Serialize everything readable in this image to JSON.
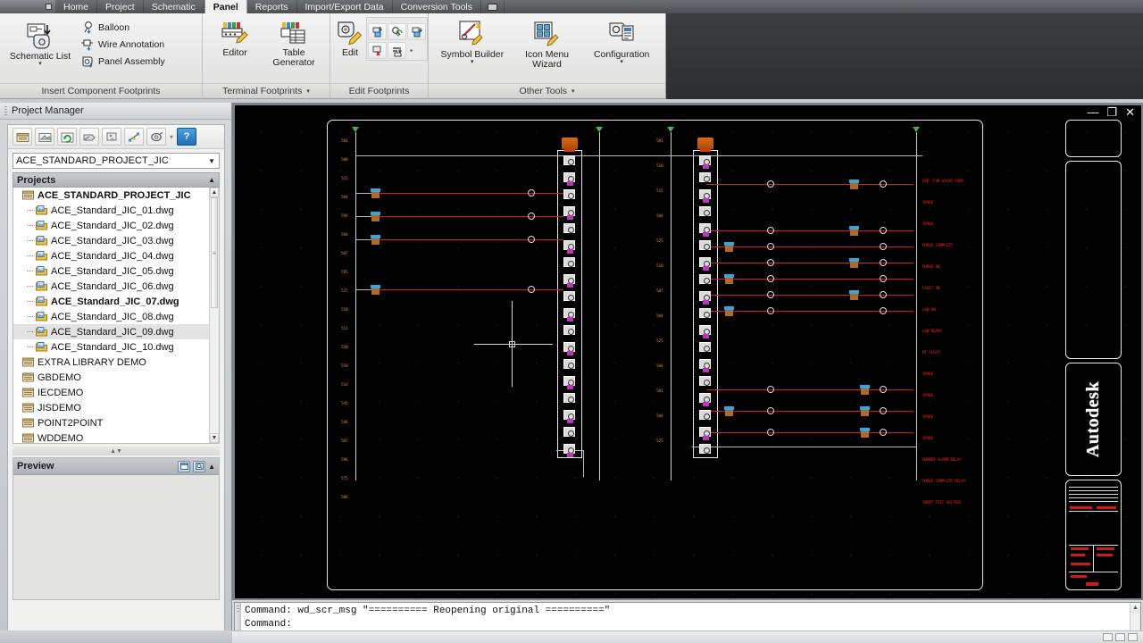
{
  "window": {
    "app_button": "application-menu",
    "controls": {
      "minimize": "—",
      "restore": "❐",
      "close": "✕"
    }
  },
  "ribbon_tabs": [
    {
      "label": "Home",
      "active": false
    },
    {
      "label": "Project",
      "active": false
    },
    {
      "label": "Schematic",
      "active": false
    },
    {
      "label": "Panel",
      "active": true
    },
    {
      "label": "Reports",
      "active": false
    },
    {
      "label": "Import/Export Data",
      "active": false
    },
    {
      "label": "Conversion Tools",
      "active": false
    }
  ],
  "ribbon_panels": [
    {
      "title": "Insert Component Footprints",
      "has_dropdown": false,
      "big": [
        {
          "label": "Schematic List",
          "icon": "schematic-list-icon",
          "split": true
        }
      ],
      "small": [
        {
          "label": "Balloon",
          "icon": "balloon-icon"
        },
        {
          "label": "Wire Annotation",
          "icon": "wire-annotation-icon"
        },
        {
          "label": "Panel Assembly",
          "icon": "panel-assembly-icon"
        }
      ]
    },
    {
      "title": "Terminal Footprints",
      "has_dropdown": true,
      "big": [
        {
          "label": "Editor",
          "icon": "terminal-editor-icon",
          "split": false
        },
        {
          "label": "Table Generator",
          "icon": "table-generator-icon",
          "split": false
        }
      ],
      "small": []
    },
    {
      "title": "Edit Footprints",
      "has_dropdown": false,
      "big": [
        {
          "label": "Edit",
          "icon": "edit-footprint-icon",
          "split": false
        }
      ],
      "grid": [
        "copy-footprint-icon",
        "find-replace-icon",
        "swap-footprint-icon",
        "delete-footprint-icon",
        "attribute-icon",
        "more-icon"
      ]
    },
    {
      "title": "Other Tools",
      "has_dropdown": true,
      "big": [
        {
          "label": "Symbol Builder",
          "icon": "symbol-builder-icon",
          "split": true
        },
        {
          "label": "Icon Menu Wizard",
          "icon": "icon-menu-wizard-icon",
          "split": false
        },
        {
          "label": "Configuration",
          "icon": "configuration-icon",
          "split": true
        }
      ],
      "small": []
    }
  ],
  "project_manager": {
    "title": "Project Manager",
    "toolbar": [
      "new-project-icon",
      "open-project-icon",
      "refresh-icon",
      "project-task-list-icon",
      "publish-plot-icon",
      "project-wide-update-icon",
      "settings-icon",
      "help-icon"
    ],
    "active_project": "ACE_STANDARD_PROJECT_JIC",
    "section_label": "Projects",
    "tree": [
      {
        "label": "ACE_STANDARD_PROJECT_JIC",
        "type": "project",
        "level": 0,
        "bold": true,
        "selected": false
      },
      {
        "label": "ACE_Standard_JIC_01.dwg",
        "type": "drawing",
        "level": 1,
        "bold": false,
        "selected": false
      },
      {
        "label": "ACE_Standard_JIC_02.dwg",
        "type": "drawing",
        "level": 1,
        "bold": false,
        "selected": false
      },
      {
        "label": "ACE_Standard_JIC_03.dwg",
        "type": "drawing",
        "level": 1,
        "bold": false,
        "selected": false
      },
      {
        "label": "ACE_Standard_JIC_04.dwg",
        "type": "drawing",
        "level": 1,
        "bold": false,
        "selected": false
      },
      {
        "label": "ACE_Standard_JIC_05.dwg",
        "type": "drawing",
        "level": 1,
        "bold": false,
        "selected": false
      },
      {
        "label": "ACE_Standard_JIC_06.dwg",
        "type": "drawing",
        "level": 1,
        "bold": false,
        "selected": false
      },
      {
        "label": "ACE_Standard_JIC_07.dwg",
        "type": "drawing",
        "level": 1,
        "bold": true,
        "selected": false
      },
      {
        "label": "ACE_Standard_JIC_08.dwg",
        "type": "drawing",
        "level": 1,
        "bold": false,
        "selected": false
      },
      {
        "label": "ACE_Standard_JIC_09.dwg",
        "type": "drawing",
        "level": 1,
        "bold": false,
        "selected": true
      },
      {
        "label": "ACE_Standard_JIC_10.dwg",
        "type": "drawing",
        "level": 1,
        "bold": false,
        "selected": false
      },
      {
        "label": "EXTRA LIBRARY DEMO",
        "type": "project",
        "level": 0,
        "bold": false,
        "selected": false
      },
      {
        "label": "GBDEMO",
        "type": "project",
        "level": 0,
        "bold": false,
        "selected": false
      },
      {
        "label": "IECDEMO",
        "type": "project",
        "level": 0,
        "bold": false,
        "selected": false
      },
      {
        "label": "JISDEMO",
        "type": "project",
        "level": 0,
        "bold": false,
        "selected": false
      },
      {
        "label": "POINT2POINT",
        "type": "project",
        "level": 0,
        "bold": false,
        "selected": false
      },
      {
        "label": "WDDEMO",
        "type": "project",
        "level": 0,
        "bold": false,
        "selected": false
      }
    ],
    "preview": {
      "title": "Preview",
      "buttons": [
        "preview-pane-icon",
        "zoom-preview-icon"
      ],
      "collapse": "▲"
    }
  },
  "drawing": {
    "title_block_text": "Autodesk",
    "rung_numbers_left": [
      "501",
      "508",
      "515",
      "504",
      "594",
      "594",
      "507",
      "595",
      "525",
      "550",
      "511",
      "550",
      "550",
      "514",
      "545",
      "546",
      "507",
      "596",
      "575",
      "586"
    ],
    "rung_numbers_mid": [
      "501",
      "510",
      "515",
      "504",
      "525",
      "510",
      "507",
      "504",
      "525",
      "504",
      "501",
      "504",
      "525"
    ],
    "descriptions": [
      "AIR 'FOR VALVE CONT.",
      "SPARE",
      "SPARE",
      "PURGE COMPLETE",
      "PURGE ON",
      "FAULT ON",
      "LOW ON",
      "LOW READY",
      "MT FLOAT",
      "SPARE",
      "SPARE",
      "SPARE",
      "SPARE",
      "BURNER ALARM RELAY",
      "PURGE COMPLETE RELAY",
      "INPUT TEST VOLTAGE"
    ]
  },
  "command_line": {
    "lines": [
      "Command: wd_scr_msg \"========== Reopening original ==========\"",
      "Command:"
    ],
    "scroll_up": "▲",
    "scroll_down": "▼"
  }
}
